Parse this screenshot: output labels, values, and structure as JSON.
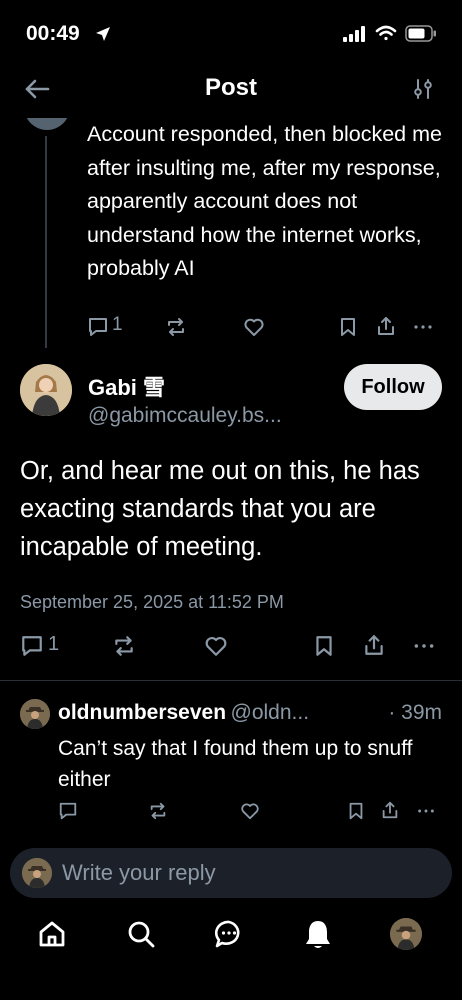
{
  "status_bar": {
    "time": "00:49"
  },
  "header": {
    "title": "Post"
  },
  "parent_post": {
    "text": "Account responded, then blocked me after insulting me, after my response, apparently account does not understand how the internet works, probably AI",
    "reply_count": "1"
  },
  "main_post": {
    "display_name": "Gabi 雪",
    "handle": "@gabimccauley.bs...",
    "follow_label": "Follow",
    "text": "Or, and hear me out on this, he has exacting standards that you are incapable of meeting.",
    "timestamp": "September 25, 2025 at 11:52 PM",
    "reply_count": "1"
  },
  "reply": {
    "display_name": "oldnumberseven",
    "handle": "@oldn...",
    "age": "· 39m",
    "text": "Can’t say that I found them up to snuff either"
  },
  "composer": {
    "placeholder": "Write your reply"
  },
  "icons": {
    "back": "back-arrow-icon",
    "filter": "sliders-icon",
    "reply": "reply-bubble-icon",
    "repost": "repost-icon",
    "like": "heart-icon",
    "bookmark": "bookmark-icon",
    "share": "share-icon",
    "more": "more-dots-icon",
    "home": "home-icon",
    "search": "search-icon",
    "chat": "chat-icon",
    "notifications": "bell-icon"
  },
  "colors": {
    "background": "#000000",
    "muted": "#8b98a5",
    "follow_bg": "#e7e9ea",
    "composer_bg": "#1c2129"
  }
}
